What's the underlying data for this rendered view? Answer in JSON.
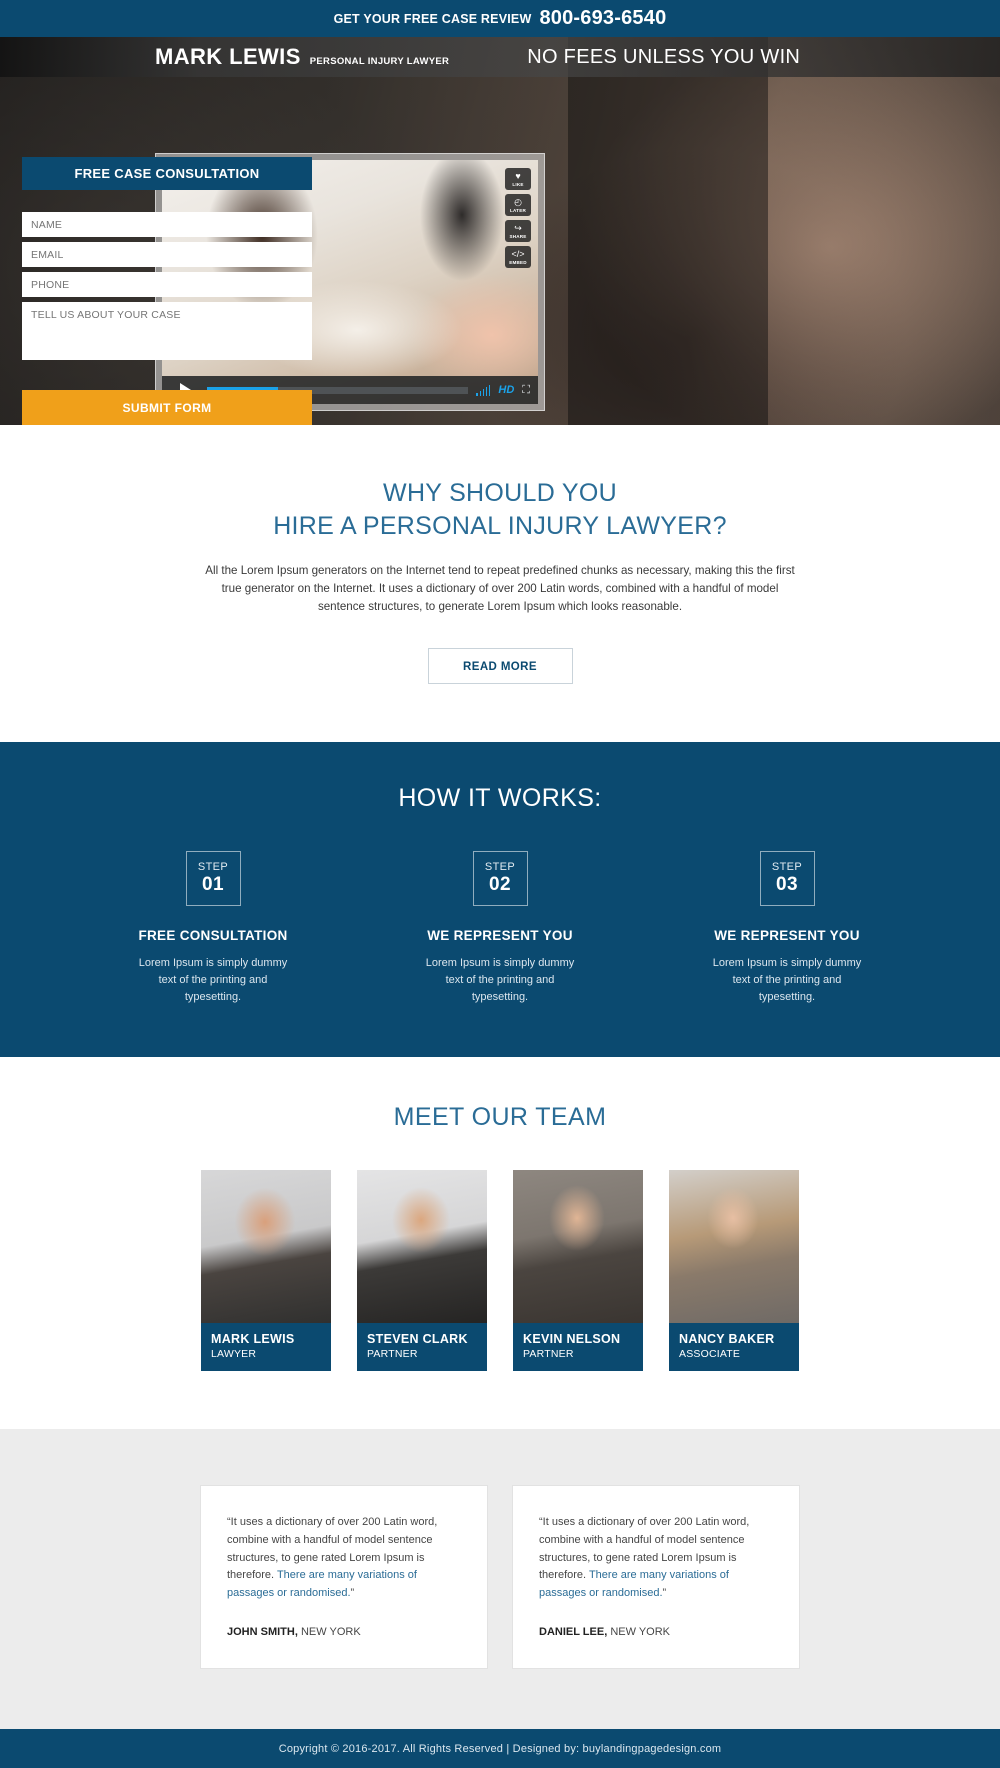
{
  "topbar": {
    "text": "GET YOUR FREE CASE REVIEW",
    "phone": "800-693-6540"
  },
  "navbar": {
    "brand_name": "MARK LEWIS",
    "brand_sub": "PERSONAL INJURY LAWYER",
    "tagline": "NO FEES UNLESS YOU WIN"
  },
  "video": {
    "side_buttons": [
      {
        "icon": "heart-icon",
        "glyph": "♥",
        "label": "LIKE"
      },
      {
        "icon": "clock-icon",
        "glyph": "◴",
        "label": "LATER"
      },
      {
        "icon": "share-icon",
        "glyph": "↪",
        "label": "SHARE"
      },
      {
        "icon": "embed-icon",
        "glyph": "</>",
        "label": "EMBED"
      }
    ],
    "hd_label": "HD",
    "fullscreen_glyph": "⛶",
    "play_label": "Play"
  },
  "form": {
    "heading": "FREE CASE CONSULTATION",
    "name_placeholder": "NAME",
    "email_placeholder": "EMAIL",
    "phone_placeholder": "PHONE",
    "message_placeholder": "TELL US ABOUT YOUR CASE",
    "submit_label": "SUBMIT FORM"
  },
  "why": {
    "title_line1": "WHY SHOULD YOU",
    "title_line2": "HIRE A PERSONAL INJURY LAWYER?",
    "body": "All the Lorem Ipsum generators on the Internet tend to repeat predefined chunks as necessary, making this the first true generator on the Internet. It uses a dictionary of over 200 Latin words, combined with a handful of model sentence structures, to generate Lorem Ipsum which looks reasonable.",
    "read_more_label": "READ MORE"
  },
  "how": {
    "title": "HOW IT WORKS:",
    "step_word": "STEP",
    "steps": [
      {
        "number": "01",
        "title": "FREE CONSULTATION",
        "desc": "Lorem Ipsum is simply dummy text of the printing and typesetting."
      },
      {
        "number": "02",
        "title": "WE REPRESENT YOU",
        "desc": "Lorem Ipsum is simply dummy text of the printing and typesetting."
      },
      {
        "number": "03",
        "title": "WE REPRESENT YOU",
        "desc": "Lorem Ipsum is simply dummy text of the printing and typesetting."
      }
    ]
  },
  "team": {
    "title": "MEET OUR TEAM",
    "members": [
      {
        "name": "MARK LEWIS",
        "role": "LAWYER"
      },
      {
        "name": "STEVEN CLARK",
        "role": "PARTNER"
      },
      {
        "name": "KEVIN NELSON",
        "role": "PARTNER"
      },
      {
        "name": "NANCY BAKER",
        "role": "ASSOCIATE"
      }
    ]
  },
  "testimonials": [
    {
      "quote_start": "“It uses a dictionary of over 200 Latin word, combine with a handful of model sentence structures, to gene rated Lorem Ipsum is therefore. ",
      "quote_highlight": "There are many variations of passages or randomised.",
      "quote_end": "”",
      "author": "JOHN SMITH,",
      "location": " NEW YORK"
    },
    {
      "quote_start": "“It uses a dictionary of over 200 Latin word, combine with a handful of model sentence structures, to gene rated Lorem Ipsum is therefore. ",
      "quote_highlight": "There are many variations of passages or randomised.",
      "quote_end": "”",
      "author": "DANIEL LEE,",
      "location": " NEW YORK"
    }
  ],
  "footer": {
    "text": "Copyright © 2016-2017. All Rights Reserved  |  Designed by: buylandingpagedesign.com"
  },
  "colors": {
    "brand_blue": "#0b4a70",
    "heading_blue": "#2a6c96",
    "accent_orange": "#f0a01a",
    "video_accent": "#1ba2e8"
  }
}
